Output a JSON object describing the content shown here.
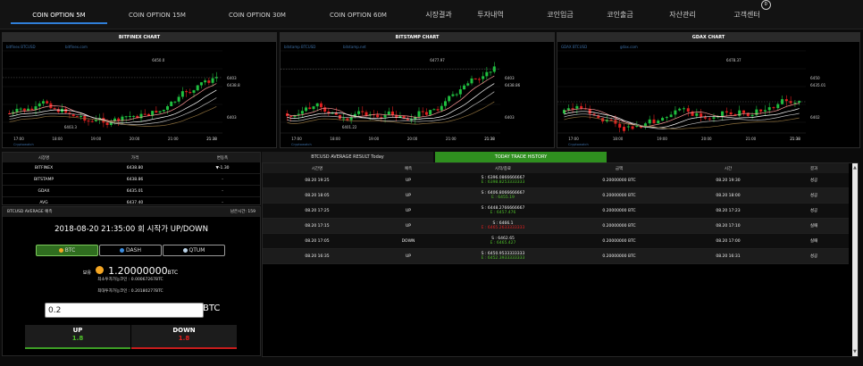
{
  "nav": {
    "items": [
      "COIN OPTION 5M",
      "COIN OPTION 15M",
      "COIN OPTION 30M",
      "COIN OPTION 60M",
      "시장결과",
      "투자내역",
      "코인입금",
      "코인출금",
      "자산관리",
      "고객센터"
    ],
    "badge": "0"
  },
  "charts": [
    {
      "title": "BITFINEX CHART",
      "src": "bitfinex BTCUSD",
      "url": "bitfinex.com",
      "price_top": "6450.0",
      "price_cur": "6438.8",
      "p1": "6403",
      "p2": "6450",
      "p3": "6403",
      "low": "6403.3",
      "times": [
        "17:00",
        "18:00",
        "19:00",
        "20:00",
        "21:00",
        "21:38"
      ],
      "wm": "Cryptowatch"
    },
    {
      "title": "BITSTAMP CHART",
      "src": "bitstamp BTCUSD",
      "url": "bitstamp.net",
      "price_top": "6477.97",
      "price_cur": "6438.86",
      "p1": "6403",
      "p2": "6450",
      "p3": "6403",
      "low": "6401.22",
      "times": [
        "17:00",
        "18:00",
        "19:00",
        "20:00",
        "21:00",
        "21:38"
      ],
      "wm": "Cryptowatch"
    },
    {
      "title": "GDAX CHART",
      "src": "GDAX BTCUSD",
      "url": "gdax.com",
      "price_top": "6478.37",
      "price_cur": "6435.01",
      "p1": "6450",
      "p2": "6435",
      "p3": "6402",
      "low": "",
      "times": [
        "17:00",
        "18:00",
        "19:00",
        "20:00",
        "21:00",
        "21:38"
      ],
      "wm": "Cryptowatch"
    }
  ],
  "exchange": {
    "headers": [
      "시장명",
      "가격",
      "변동폭"
    ],
    "rows": [
      {
        "name": "BITFINEX",
        "price": "6438.80",
        "change": "▼-1.30"
      },
      {
        "name": "BITSTAMP",
        "price": "6438.86",
        "change": "-"
      },
      {
        "name": "GDAX",
        "price": "6435.01",
        "change": "-"
      },
      {
        "name": "AVG",
        "price": "6437.40",
        "change": "-"
      }
    ]
  },
  "betting": {
    "header_left": "BTCUSD AVERAGE 예측",
    "header_right": "남은시간: 159",
    "round_title": "2018-08-20 21:35:00 회 시작가 UP/DOWN",
    "coins": [
      "BTC",
      "DASH",
      "QTUM"
    ],
    "balance_label": "보유",
    "balance_value": "1.20000000",
    "balance_unit": "BTC",
    "min_label": "최소투자가능코인 : ",
    "min_value": "0.00067267",
    "min_unit": "BTC",
    "max_label": "최대투자가능코인 : ",
    "max_value": "0.20180277",
    "max_unit": "BTC",
    "amount": "0.2",
    "amount_unit": "BTC",
    "up_label": "UP",
    "up_value": "1.8",
    "down_label": "DOWN",
    "down_value": "1.8"
  },
  "tabs": [
    "BTCUSD AVERAGE RESULT Today",
    "TODAY TRADE HISTORY"
  ],
  "history": {
    "headers": [
      "시간명",
      "예측",
      "시작/종료",
      "금액",
      "시간",
      "결과"
    ],
    "rows": [
      {
        "round": "08.20 19:25",
        "pred": "UP",
        "start": "S : 6396.0866666667",
        "end": "E : 6398.8253333333",
        "amount": "0.20000000 BTC",
        "time": "08.20 19:30",
        "result": "성공"
      },
      {
        "round": "08.20 18:05",
        "pred": "UP",
        "start": "S : 6406.8066666667",
        "end": "E : 6455.19",
        "amount": "0.20000000 BTC",
        "time": "08.20 18:00",
        "result": "성공"
      },
      {
        "round": "08.20 17:25",
        "pred": "UP",
        "start": "S : 6448.2766666667",
        "end": "E : 6457.476",
        "amount": "0.20000000 BTC",
        "time": "08.20 17:23",
        "result": "성공"
      },
      {
        "round": "08.20 17:15",
        "pred": "UP",
        "start": "S : 6466.1",
        "end": "E : 6465.2633333333",
        "amount": "0.20000000 BTC",
        "time": "08.20 17:10",
        "result": "실패"
      },
      {
        "round": "08.20 17:05",
        "pred": "DOWN",
        "start": "S : 6462.65",
        "end": "E : 6465.427",
        "amount": "0.20000000 BTC",
        "time": "08.20 17:00",
        "result": "실패"
      },
      {
        "round": "08.20 16:35",
        "pred": "UP",
        "start": "S : 6450.9533333333",
        "end": "E : 6452.3933333333",
        "amount": "0.20000000 BTC",
        "time": "08.20 16:31",
        "result": "성공"
      }
    ]
  },
  "colors": {
    "accent": "#2f7fd9",
    "up": "#4fbf2a",
    "down": "#e02020",
    "active_tab": "#2f8f1f"
  }
}
